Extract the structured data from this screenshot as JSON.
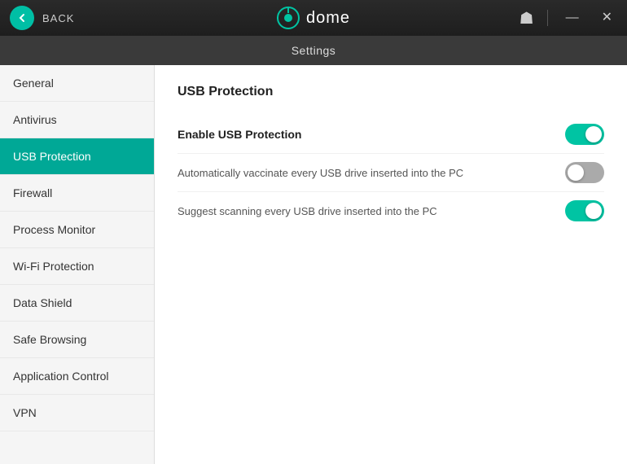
{
  "titlebar": {
    "back_label": "BACK",
    "logo_text": "dome",
    "minimize_label": "—",
    "close_label": "✕"
  },
  "settings_bar": {
    "label": "Settings"
  },
  "sidebar": {
    "items": [
      {
        "id": "general",
        "label": "General",
        "active": false
      },
      {
        "id": "antivirus",
        "label": "Antivirus",
        "active": false
      },
      {
        "id": "usb-protection",
        "label": "USB Protection",
        "active": true
      },
      {
        "id": "firewall",
        "label": "Firewall",
        "active": false
      },
      {
        "id": "process-monitor",
        "label": "Process Monitor",
        "active": false
      },
      {
        "id": "wifi-protection",
        "label": "Wi-Fi Protection",
        "active": false
      },
      {
        "id": "data-shield",
        "label": "Data Shield",
        "active": false
      },
      {
        "id": "safe-browsing",
        "label": "Safe Browsing",
        "active": false
      },
      {
        "id": "application-control",
        "label": "Application Control",
        "active": false
      },
      {
        "id": "vpn",
        "label": "VPN",
        "active": false
      }
    ]
  },
  "content": {
    "section_title": "USB Protection",
    "settings": [
      {
        "id": "enable-usb-protection",
        "label": "Enable USB Protection",
        "bold": true,
        "state": "on"
      },
      {
        "id": "auto-vaccinate",
        "label": "Automatically vaccinate every USB drive inserted into the PC",
        "bold": false,
        "state": "off"
      },
      {
        "id": "suggest-scan",
        "label": "Suggest scanning every USB drive inserted into the PC",
        "bold": false,
        "state": "on"
      }
    ]
  }
}
